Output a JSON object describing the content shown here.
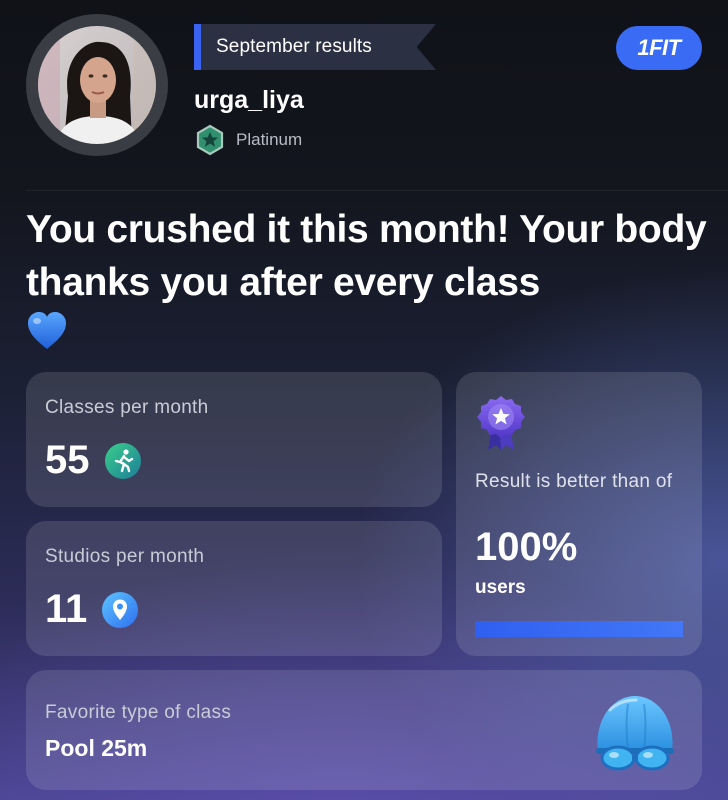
{
  "header": {
    "period_label": "September results",
    "brand": "1FIT",
    "username": "urga_liya",
    "tier": "Platinum"
  },
  "headline": "You crushed it this month! Your body thanks you after every class",
  "stats": {
    "classes": {
      "label": "Classes per month",
      "value": "55",
      "icon": "running-person-icon"
    },
    "studios": {
      "label": "Studios per month",
      "value": "11",
      "icon": "map-pin-icon"
    }
  },
  "result": {
    "label": "Result is better than of",
    "value": "100%",
    "unit": "users",
    "progress_fraction": 1.0,
    "icon": "star-medal-icon"
  },
  "favorite": {
    "label": "Favorite type of class",
    "value": "Pool 25m",
    "icon": "swim-cap-goggles-icon"
  },
  "colors": {
    "accent_blue": "#3b63f2",
    "tier_green": "#2f8f6f",
    "medal_purple": "#6b4fe0",
    "heart_blue": "#2f7cf6"
  }
}
